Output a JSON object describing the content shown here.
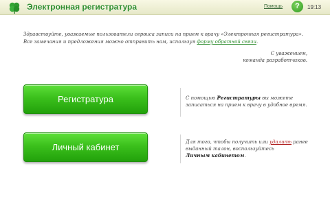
{
  "header": {
    "title": "Электронная регистратура",
    "help_link": "Помощь",
    "help_button": "?",
    "time": "19:13",
    "logo_icon": "clover-icon",
    "accent_color": "#2e8d2e"
  },
  "intro": {
    "line1": "Здравствуйте, уважаемые пользователи сервиса записи на прием к врачу «Электронная регистратура».",
    "line2_prefix": "Все замечания и предложения можно отправить нам, используя ",
    "feedback_link": "форму обратной связи",
    "line2_suffix": ".",
    "signature_line1": "С уважением,",
    "signature_line2": "команда разработчиков."
  },
  "registry": {
    "button_label": "Регистратура",
    "desc_prefix": "С помощью ",
    "desc_bold": "Регистратуры",
    "desc_suffix": " вы можете записаться на прием к врачу в удобное время."
  },
  "cabinet": {
    "button_label": "Личный кабинет",
    "desc_prefix": "Для того, чтобы получить или ",
    "desc_underlined": "удалить",
    "desc_middle": " ранее выданный талон, воспользуйтесь",
    "desc_bold": "Личным кабинетом",
    "desc_suffix": "."
  },
  "colors": {
    "button_green": "#3bc01c",
    "header_background": "#eef0d6"
  }
}
